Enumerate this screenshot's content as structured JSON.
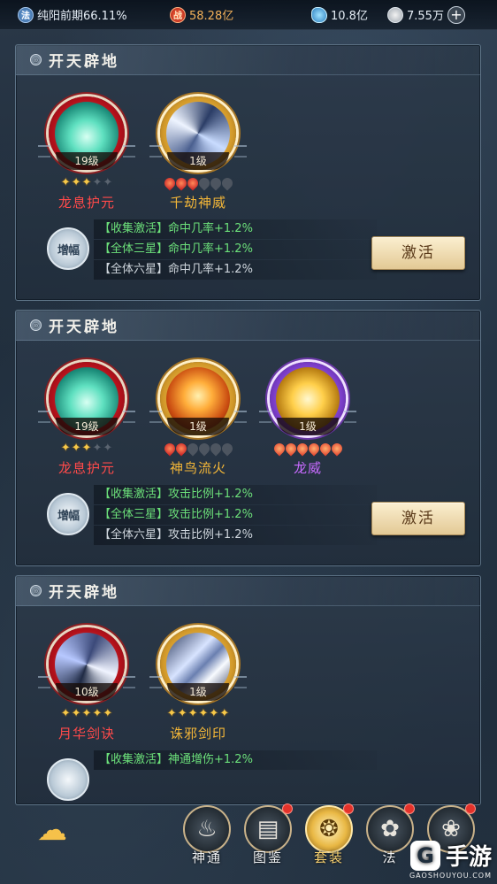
{
  "topbar": {
    "realm": {
      "icon": "realm-icon",
      "text": "纯阳前期66.11%"
    },
    "power": {
      "icon": "power-icon",
      "text": "58.28亿"
    },
    "gems": {
      "icon": "gem-icon",
      "text": "10.8亿"
    },
    "coins": {
      "icon": "coin-icon",
      "text": "7.55万"
    }
  },
  "panels": [
    {
      "title": "开天辟地",
      "skills": [
        {
          "name": "龙息护元",
          "level": "19级",
          "stars": 3,
          "stars_max": 5,
          "marker": "star",
          "rarity": "red"
        },
        {
          "name": "千劫神威",
          "level": "1级",
          "stars": 3,
          "stars_max": 6,
          "marker": "drop",
          "rarity": "gold"
        }
      ],
      "badge": "增幅",
      "bonus": [
        {
          "text": "【收集激活】命中几率+1.2%",
          "active": true
        },
        {
          "text": "【全体三星】命中几率+1.2%",
          "active": true
        },
        {
          "text": "【全体六星】命中几率+1.2%",
          "active": false
        }
      ],
      "button": "激活"
    },
    {
      "title": "开天辟地",
      "skills": [
        {
          "name": "龙息护元",
          "level": "19级",
          "stars": 3,
          "stars_max": 5,
          "marker": "star",
          "rarity": "red"
        },
        {
          "name": "神鸟流火",
          "level": "1级",
          "stars": 2,
          "stars_max": 6,
          "marker": "drop",
          "rarity": "gold"
        },
        {
          "name": "龙威",
          "level": "1级",
          "stars": 6,
          "stars_max": 6,
          "marker": "drop",
          "rarity": "purple"
        }
      ],
      "badge": "增幅",
      "bonus": [
        {
          "text": "【收集激活】攻击比例+1.2%",
          "active": true
        },
        {
          "text": "【全体三星】攻击比例+1.2%",
          "active": true
        },
        {
          "text": "【全体六星】攻击比例+1.2%",
          "active": false
        }
      ],
      "button": "激活"
    },
    {
      "title": "开天辟地",
      "skills": [
        {
          "name": "月华剑诀",
          "level": "10级",
          "stars": 5,
          "stars_max": 5,
          "marker": "star",
          "rarity": "red"
        },
        {
          "name": "诛邪剑印",
          "level": "1级",
          "stars": 6,
          "stars_max": 6,
          "marker": "star",
          "rarity": "gold"
        }
      ],
      "bonus": [
        {
          "text": "【收集激活】神通增伤+1.2%",
          "active": true
        }
      ]
    }
  ],
  "bottom_nav": {
    "tabs": [
      {
        "label": "神通",
        "icon": "flame-spirit-icon",
        "active": false,
        "badge": false
      },
      {
        "label": "图鉴",
        "icon": "scroll-book-icon",
        "active": false,
        "badge": true
      },
      {
        "label": "套装",
        "icon": "fan-icon",
        "active": true,
        "badge": true
      },
      {
        "label": "法",
        "icon": "lotus-icon",
        "active": false,
        "badge": true
      },
      {
        "label": "",
        "icon": "flower-emblem-icon",
        "active": false,
        "badge": true
      }
    ]
  },
  "watermark": {
    "brand": "手游",
    "site": "GAOSHOUYOU.COM"
  },
  "colors": {
    "active_green": "#6ce07a",
    "name_red": "#ff4a4a",
    "name_gold": "#f3b638",
    "name_purple": "#c86bff",
    "power_orange": "#f4b25a"
  }
}
